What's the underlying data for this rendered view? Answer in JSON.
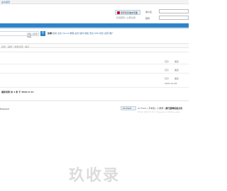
{
  "topbar": {
    "link": "设为首页"
  },
  "header": {
    "qr_button": "用手机扫描本页面",
    "header_links": "找回密码 | 立即注册",
    "username_label": "用户名",
    "password_label": "密码"
  },
  "search": {
    "placeholder": "请输入搜索内容",
    "button_icon": "search-icon",
    "hot_label": "热搜:",
    "hot_links": "活动 交友 discuz 教程 站长 插件 模板 安全 SEO 优化 运营 推广"
  },
  "breadcrumb": "论坛 › 站务 › 综合交流 › 帖子",
  "rows": [
    {
      "key": "回复",
      "val": "发表"
    },
    {
      "key": "回复",
      "val": "发表"
    },
    {
      "key": "回复",
      "val": "发表",
      "date": "2022-12-05"
    }
  ],
  "summary": "最新发表 共 1 条 于 2022-5-11",
  "footer": {
    "left": "Powered",
    "archive_button": "Archiver",
    "links": [
      "Archiver",
      "手机版",
      "小黑屋"
    ],
    "site_name": "旅行团网民俗文化",
    "small_text": "GMT+8, 2024-3-29 12:27, Processed in 0.036061 second(s)"
  },
  "watermark": "玖收录",
  "colors": {
    "nav": "#2f84c8",
    "accent": "#c8102e"
  }
}
